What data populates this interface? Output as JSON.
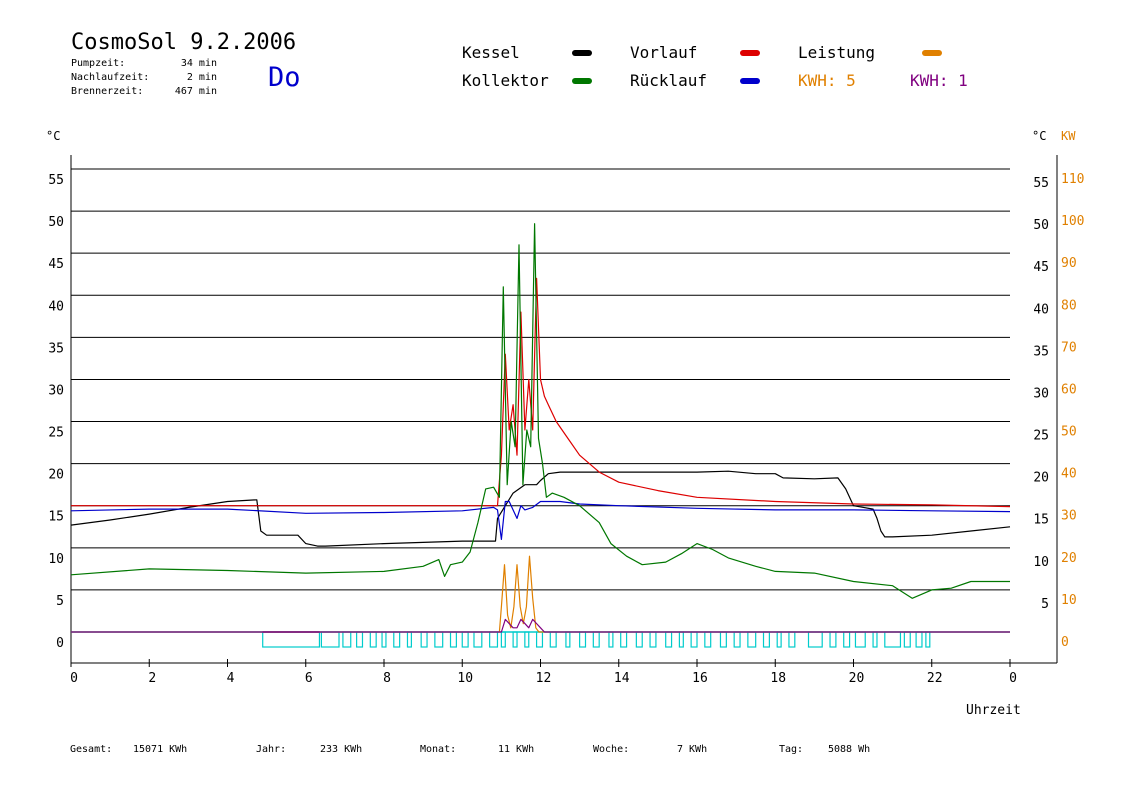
{
  "header": {
    "title": "CosmoSol 9.2.2006",
    "day": "Do",
    "info": [
      {
        "label": "Pumpzeit:",
        "value": "34 min"
      },
      {
        "label": "Nachlaufzeit:",
        "value": "2 min"
      },
      {
        "label": "Brennerzeit:",
        "value": "467 min"
      }
    ]
  },
  "legend": {
    "kessel": "Kessel",
    "kollektor": "Kollektor",
    "vorlauf": "Vorlauf",
    "ruecklauf": "Rücklauf",
    "leistung": "Leistung",
    "kwh1": "KWH: 5",
    "kwh2": "KWH: 1"
  },
  "colors": {
    "kessel": "#000000",
    "kollektor": "#007700",
    "vorlauf": "#dd0000",
    "ruecklauf": "#0000cc",
    "leistung": "#e08000",
    "kwh2": "#800080",
    "pump": "#00cccc"
  },
  "footer": {
    "gesamt_label": "Gesamt:",
    "gesamt_value": "15071 KWh",
    "jahr_label": "Jahr:",
    "jahr_value": "233 KWh",
    "monat_label": "Monat:",
    "monat_value": "11 KWh",
    "woche_label": "Woche:",
    "woche_value": "7 KWh",
    "tag_label": "Tag:",
    "tag_value": "5088 Wh"
  },
  "chart_data": {
    "type": "line",
    "xlabel": "Uhrzeit",
    "y_unit_left": "°C",
    "y_unit_right": "°C",
    "y2_unit": "KW",
    "xlim": [
      0,
      24
    ],
    "ylim": [
      0,
      55
    ],
    "y2lim": [
      0,
      110
    ],
    "x_ticks": [
      0,
      2,
      4,
      6,
      8,
      10,
      12,
      14,
      16,
      18,
      20,
      22,
      0
    ],
    "y_ticks": [
      0,
      5,
      10,
      15,
      20,
      25,
      30,
      35,
      40,
      45,
      50,
      55
    ],
    "y2_ticks": [
      0,
      10,
      20,
      30,
      40,
      50,
      60,
      70,
      80,
      90,
      100,
      110
    ],
    "grid": "horizontal",
    "series": [
      {
        "key": "kessel",
        "x": [
          0,
          1,
          2,
          3,
          4,
          4.75,
          4.85,
          5.0,
          5.8,
          6.0,
          6.3,
          6.5,
          8,
          10,
          10.5,
          10.85,
          10.9,
          11.1,
          11.3,
          11.6,
          11.9,
          12.0,
          12.2,
          12.5,
          14,
          15,
          16,
          16.8,
          17.5,
          18.0,
          18.2,
          19.0,
          19.6,
          19.8,
          20.0,
          20.5,
          20.6,
          20.7,
          20.8,
          21.0,
          22,
          23,
          24
        ],
        "y": [
          12.7,
          13.3,
          14.0,
          14.8,
          15.5,
          15.7,
          12.0,
          11.5,
          11.5,
          10.5,
          10.2,
          10.2,
          10.5,
          10.8,
          10.8,
          10.8,
          13.5,
          15.0,
          16.5,
          17.5,
          17.5,
          18.0,
          18.8,
          19.0,
          19.0,
          19.0,
          19.0,
          19.1,
          18.8,
          18.8,
          18.3,
          18.2,
          18.3,
          17.0,
          15.0,
          14.6,
          13.5,
          12.0,
          11.3,
          11.3,
          11.5,
          12.0,
          12.5
        ]
      },
      {
        "key": "vorlauf",
        "x": [
          0,
          4,
          8,
          10,
          10.9,
          11.0,
          11.1,
          11.2,
          11.3,
          11.4,
          11.5,
          11.6,
          11.7,
          11.8,
          11.9,
          12.0,
          12.1,
          12.2,
          12.4,
          12.7,
          13.0,
          13.5,
          14,
          15,
          16,
          18,
          20,
          22,
          24
        ],
        "y": [
          15.0,
          15.0,
          15.0,
          15.0,
          15.0,
          21.0,
          33.0,
          24.0,
          27.0,
          21.0,
          38.0,
          24.0,
          30.0,
          24.0,
          42.0,
          30.0,
          28.0,
          27.0,
          25.0,
          23.0,
          21.0,
          19.0,
          17.8,
          16.8,
          16.0,
          15.5,
          15.2,
          15.1,
          14.9
        ]
      },
      {
        "key": "ruecklauf",
        "x": [
          0,
          2,
          4,
          6,
          8,
          10,
          10.8,
          10.9,
          11.0,
          11.1,
          11.2,
          11.4,
          11.5,
          11.6,
          11.8,
          12.0,
          12.5,
          13,
          14,
          16,
          18,
          20,
          22,
          24
        ],
        "y": [
          14.4,
          14.6,
          14.6,
          14.1,
          14.2,
          14.4,
          14.8,
          14.5,
          11.0,
          15.5,
          15.5,
          13.5,
          15.0,
          14.5,
          14.8,
          15.5,
          15.5,
          15.2,
          15.0,
          14.7,
          14.5,
          14.5,
          14.4,
          14.3
        ]
      },
      {
        "key": "kollektor",
        "x": [
          0,
          2,
          4,
          6,
          8,
          9.0,
          9.4,
          9.55,
          9.7,
          10.0,
          10.2,
          10.4,
          10.6,
          10.8,
          10.95,
          11.05,
          11.15,
          11.25,
          11.35,
          11.45,
          11.55,
          11.65,
          11.75,
          11.85,
          11.95,
          12.05,
          12.15,
          12.3,
          12.6,
          13.0,
          13.5,
          13.8,
          14.2,
          14.6,
          15.2,
          15.6,
          16.0,
          16.4,
          16.8,
          17.5,
          18,
          19,
          20,
          21,
          21.5,
          22,
          22.5,
          23,
          24
        ],
        "y": [
          6.8,
          7.5,
          7.3,
          7.0,
          7.2,
          7.8,
          8.6,
          6.6,
          8.0,
          8.3,
          9.5,
          13.0,
          17.0,
          17.2,
          16.0,
          41.0,
          17.5,
          25.0,
          22.0,
          46.0,
          17.5,
          24.0,
          22.0,
          48.5,
          23.0,
          20.0,
          16.0,
          16.5,
          16.0,
          15.0,
          13.0,
          10.5,
          9.0,
          8.0,
          8.3,
          9.3,
          10.5,
          9.8,
          8.8,
          7.8,
          7.2,
          7.0,
          6.0,
          5.5,
          4.0,
          5.0,
          5.2,
          6.0,
          6.0
        ]
      },
      {
        "key": "leistung",
        "y_axis": "right",
        "x": [
          0,
          10.95,
          11.0,
          11.08,
          11.16,
          11.24,
          11.32,
          11.4,
          11.48,
          11.56,
          11.64,
          11.72,
          11.8,
          11.88,
          11.96,
          12.04,
          24
        ],
        "y": [
          0,
          0,
          6,
          16,
          4,
          1,
          6,
          16,
          6,
          2,
          6,
          18,
          8,
          1,
          0,
          0,
          0
        ]
      },
      {
        "key": "kwh2",
        "y_axis": "right",
        "x": [
          0,
          11.0,
          11.1,
          11.2,
          11.3,
          11.4,
          11.5,
          11.6,
          11.7,
          11.8,
          11.9,
          12.0,
          12.1,
          24
        ],
        "y": [
          0,
          0,
          3,
          2,
          1,
          1,
          3,
          2,
          1,
          3,
          2,
          1,
          0,
          0
        ]
      }
    ],
    "pump": {
      "baseline": 0,
      "intervals": [
        [
          4.9,
          6.35
        ],
        [
          6.4,
          6.85
        ],
        [
          6.95,
          7.15
        ],
        [
          7.3,
          7.45
        ],
        [
          7.65,
          7.8
        ],
        [
          7.95,
          8.05
        ],
        [
          8.25,
          8.4
        ],
        [
          8.6,
          8.7
        ],
        [
          8.95,
          9.1
        ],
        [
          9.3,
          9.5
        ],
        [
          9.7,
          9.85
        ],
        [
          10.0,
          10.15
        ],
        [
          10.3,
          10.5
        ],
        [
          10.7,
          10.9
        ],
        [
          11.0,
          11.1
        ],
        [
          11.3,
          11.4
        ],
        [
          11.6,
          11.7
        ],
        [
          11.9,
          12.05
        ],
        [
          12.25,
          12.4
        ],
        [
          12.65,
          12.75
        ],
        [
          13.0,
          13.15
        ],
        [
          13.35,
          13.5
        ],
        [
          13.75,
          13.85
        ],
        [
          14.05,
          14.2
        ],
        [
          14.45,
          14.6
        ],
        [
          14.8,
          14.95
        ],
        [
          15.2,
          15.35
        ],
        [
          15.55,
          15.65
        ],
        [
          15.85,
          16.0
        ],
        [
          16.2,
          16.35
        ],
        [
          16.6,
          16.75
        ],
        [
          16.95,
          17.1
        ],
        [
          17.3,
          17.5
        ],
        [
          17.7,
          17.85
        ],
        [
          18.05,
          18.15
        ],
        [
          18.35,
          18.5
        ],
        [
          18.85,
          19.2
        ],
        [
          19.4,
          19.55
        ],
        [
          19.75,
          19.9
        ],
        [
          20.05,
          20.3
        ],
        [
          20.5,
          20.6
        ],
        [
          20.8,
          21.2
        ],
        [
          21.3,
          21.45
        ],
        [
          21.6,
          21.75
        ],
        [
          21.85,
          21.95
        ]
      ]
    }
  }
}
